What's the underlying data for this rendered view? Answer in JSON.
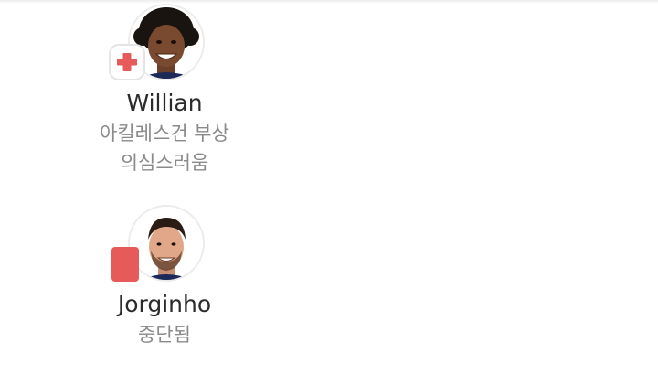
{
  "players": [
    {
      "name": "Willian",
      "status_lines": [
        "아킬레스건 부상",
        "의심스러움"
      ],
      "badge": "injury-cross-icon",
      "badge_color": "#e65a5a"
    },
    {
      "name": "Jorginho",
      "status_lines": [
        "중단됨"
      ],
      "badge": "red-card-icon",
      "badge_color": "#e65a5a"
    }
  ]
}
